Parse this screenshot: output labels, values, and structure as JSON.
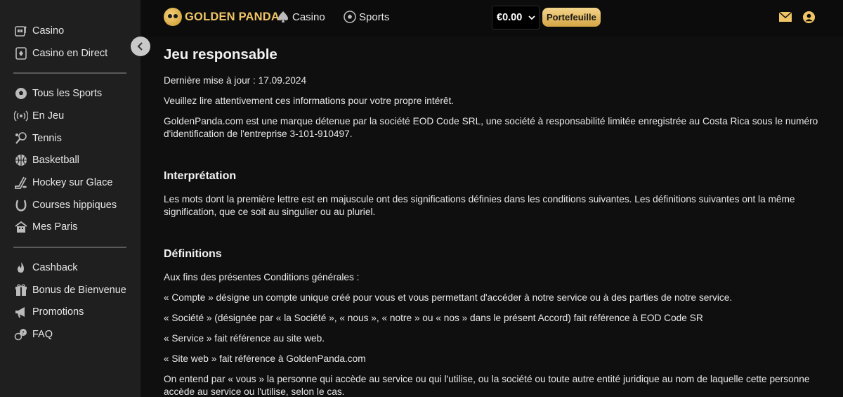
{
  "brand": {
    "name": "GOLDEN PANDA"
  },
  "topnav": {
    "casino": "Casino",
    "sports": "Sports",
    "balance": "€0.00",
    "wallet_button": "Portefeuille"
  },
  "sidebar": {
    "group1": [
      {
        "label": "Casino",
        "icon": "slot-machine-icon"
      },
      {
        "label": "Casino en Direct",
        "icon": "live-casino-icon"
      }
    ],
    "group2": [
      {
        "label": "Tous les Sports",
        "icon": "soccer-ball-icon"
      },
      {
        "label": "En Jeu",
        "icon": "live-signal-icon"
      },
      {
        "label": "Tennis",
        "icon": "tennis-icon"
      },
      {
        "label": "Basketball",
        "icon": "basketball-icon"
      },
      {
        "label": "Hockey sur Glace",
        "icon": "hockey-icon"
      },
      {
        "label": "Courses hippiques",
        "icon": "horseshoe-icon"
      },
      {
        "label": "Mes Paris",
        "icon": "my-bets-icon"
      }
    ],
    "group3": [
      {
        "label": "Cashback",
        "icon": "flame-icon"
      },
      {
        "label": "Bonus de Bienvenue",
        "icon": "gift-icon"
      },
      {
        "label": "Promotions",
        "icon": "megaphone-icon"
      },
      {
        "label": "FAQ",
        "icon": "faq-icon"
      }
    ]
  },
  "page": {
    "title": "Jeu responsable",
    "updated": "Dernière mise à jour : 17.09.2024",
    "intro1": "Veuillez lire attentivement ces informations pour votre propre intérêt.",
    "intro2": "GoldenPanda.com est une marque détenue par la société EOD Code SRL, une société à responsabilité limitée enregistrée au Costa Rica sous le numéro d'identification de l'entreprise 3-101-910497.",
    "h_interpretation": "Interprétation",
    "interpretation": "Les mots dont la première lettre est en majuscule ont des significations définies dans les conditions suivantes. Les définitions suivantes ont la même signification, que ce soit au singulier ou au pluriel.",
    "h_definitions": "Définitions",
    "def_intro": "Aux fins des présentes Conditions générales :",
    "def1": "« Compte » désigne un compte unique créé pour vous et vous permettant d'accéder à notre service ou à des parties de notre service.",
    "def2": "« Société » (désignée par « la Société », « nous », « notre » ou « nos » dans le présent Accord) fait référence à EOD Code SR",
    "def3": "« Service » fait référence au site web.",
    "def4": "« Site web » fait référence à GoldenPanda.com",
    "def5": "On entend par « vous » la personne qui accède au service ou qui l'utilise, ou la société ou toute autre entité juridique au nom de laquelle cette personne accède au service ou l'utilise, selon le cas."
  },
  "colors": {
    "accent": "#f0c565",
    "sidebar_bg": "#1f1f1f",
    "page_bg": "#0f0f0f"
  }
}
